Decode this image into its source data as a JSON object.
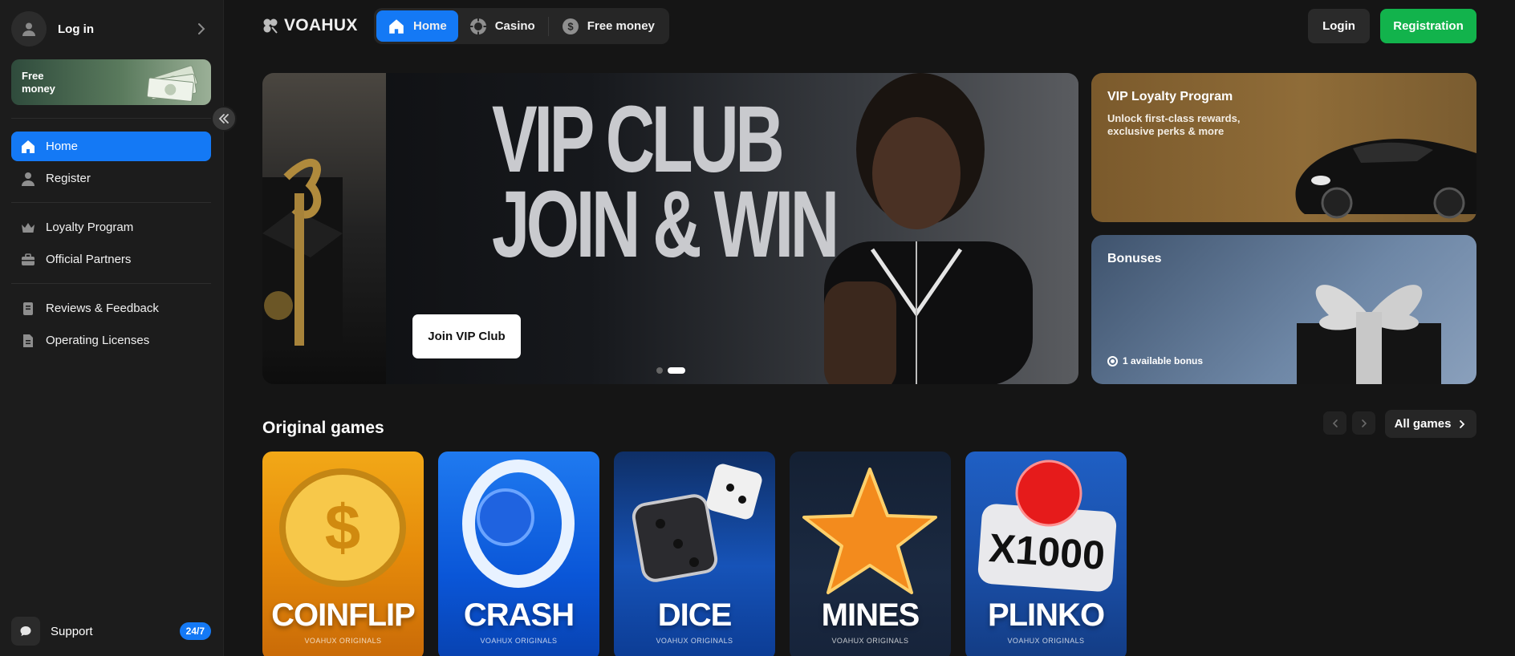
{
  "sidebar": {
    "login_label": "Log in",
    "free_money_label": "Free money",
    "items": [
      {
        "label": "Home",
        "icon": "home-icon"
      },
      {
        "label": "Register",
        "icon": "user-icon"
      },
      {
        "label": "Loyalty Program",
        "icon": "crown-icon"
      },
      {
        "label": "Official Partners",
        "icon": "briefcase-icon"
      },
      {
        "label": "Reviews & Feedback",
        "icon": "bookmark-icon"
      },
      {
        "label": "Operating Licenses",
        "icon": "document-icon"
      }
    ],
    "support_label": "Support",
    "support_badge": "24/7"
  },
  "header": {
    "brand": "VOAHUX",
    "tabs": [
      {
        "label": "Home",
        "icon": "home-icon"
      },
      {
        "label": "Casino",
        "icon": "chip-icon"
      },
      {
        "label": "Free money",
        "icon": "dollar-coin-icon"
      }
    ],
    "login_label": "Login",
    "register_label": "Registration"
  },
  "hero": {
    "title_line1": "VIP CLUB",
    "title_line2": "JOIN & WIN",
    "cta_label": "Join VIP Club",
    "active_slide": 2,
    "slide_count": 2
  },
  "promos": {
    "vip": {
      "title": "VIP Loyalty Program",
      "subtitle": "Unlock first-class rewards, exclusive perks & more"
    },
    "bonuses": {
      "title": "Bonuses",
      "count_label": "1 available bonus"
    }
  },
  "games": {
    "section_title": "Original games",
    "all_label": "All games",
    "items": [
      {
        "name": "COINFLIP",
        "sub": "VOAHUX ORIGINALS"
      },
      {
        "name": "CRASH",
        "sub": "VOAHUX ORIGINALS"
      },
      {
        "name": "DICE",
        "sub": "VOAHUX ORIGINALS"
      },
      {
        "name": "MINES",
        "sub": "VOAHUX ORIGINALS"
      },
      {
        "name": "PLINKO",
        "sub": "VOAHUX ORIGINALS"
      }
    ]
  },
  "colors": {
    "accent": "#1479f5",
    "register": "#12b34c",
    "background": "#151515",
    "sidebar": "#1c1c1c"
  }
}
